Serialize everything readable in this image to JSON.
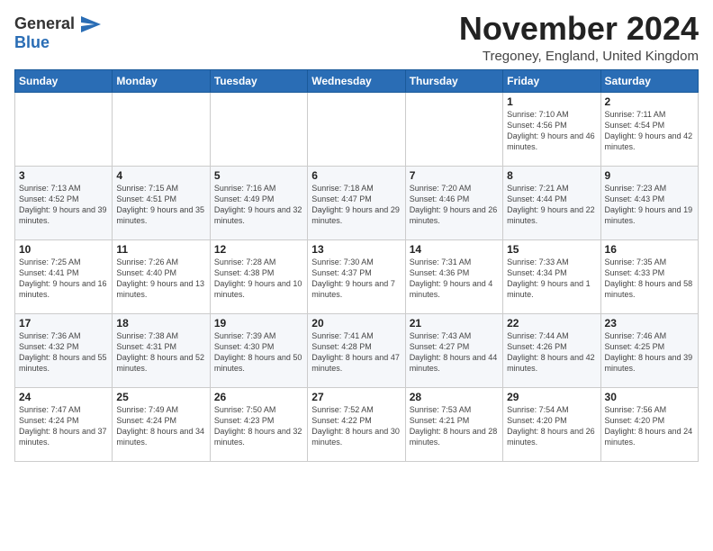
{
  "logo": {
    "line1": "General",
    "line2": "Blue"
  },
  "title": "November 2024",
  "location": "Tregoney, England, United Kingdom",
  "weekdays": [
    "Sunday",
    "Monday",
    "Tuesday",
    "Wednesday",
    "Thursday",
    "Friday",
    "Saturday"
  ],
  "weeks": [
    [
      {
        "day": "",
        "info": ""
      },
      {
        "day": "",
        "info": ""
      },
      {
        "day": "",
        "info": ""
      },
      {
        "day": "",
        "info": ""
      },
      {
        "day": "",
        "info": ""
      },
      {
        "day": "1",
        "info": "Sunrise: 7:10 AM\nSunset: 4:56 PM\nDaylight: 9 hours and 46 minutes."
      },
      {
        "day": "2",
        "info": "Sunrise: 7:11 AM\nSunset: 4:54 PM\nDaylight: 9 hours and 42 minutes."
      }
    ],
    [
      {
        "day": "3",
        "info": "Sunrise: 7:13 AM\nSunset: 4:52 PM\nDaylight: 9 hours and 39 minutes."
      },
      {
        "day": "4",
        "info": "Sunrise: 7:15 AM\nSunset: 4:51 PM\nDaylight: 9 hours and 35 minutes."
      },
      {
        "day": "5",
        "info": "Sunrise: 7:16 AM\nSunset: 4:49 PM\nDaylight: 9 hours and 32 minutes."
      },
      {
        "day": "6",
        "info": "Sunrise: 7:18 AM\nSunset: 4:47 PM\nDaylight: 9 hours and 29 minutes."
      },
      {
        "day": "7",
        "info": "Sunrise: 7:20 AM\nSunset: 4:46 PM\nDaylight: 9 hours and 26 minutes."
      },
      {
        "day": "8",
        "info": "Sunrise: 7:21 AM\nSunset: 4:44 PM\nDaylight: 9 hours and 22 minutes."
      },
      {
        "day": "9",
        "info": "Sunrise: 7:23 AM\nSunset: 4:43 PM\nDaylight: 9 hours and 19 minutes."
      }
    ],
    [
      {
        "day": "10",
        "info": "Sunrise: 7:25 AM\nSunset: 4:41 PM\nDaylight: 9 hours and 16 minutes."
      },
      {
        "day": "11",
        "info": "Sunrise: 7:26 AM\nSunset: 4:40 PM\nDaylight: 9 hours and 13 minutes."
      },
      {
        "day": "12",
        "info": "Sunrise: 7:28 AM\nSunset: 4:38 PM\nDaylight: 9 hours and 10 minutes."
      },
      {
        "day": "13",
        "info": "Sunrise: 7:30 AM\nSunset: 4:37 PM\nDaylight: 9 hours and 7 minutes."
      },
      {
        "day": "14",
        "info": "Sunrise: 7:31 AM\nSunset: 4:36 PM\nDaylight: 9 hours and 4 minutes."
      },
      {
        "day": "15",
        "info": "Sunrise: 7:33 AM\nSunset: 4:34 PM\nDaylight: 9 hours and 1 minute."
      },
      {
        "day": "16",
        "info": "Sunrise: 7:35 AM\nSunset: 4:33 PM\nDaylight: 8 hours and 58 minutes."
      }
    ],
    [
      {
        "day": "17",
        "info": "Sunrise: 7:36 AM\nSunset: 4:32 PM\nDaylight: 8 hours and 55 minutes."
      },
      {
        "day": "18",
        "info": "Sunrise: 7:38 AM\nSunset: 4:31 PM\nDaylight: 8 hours and 52 minutes."
      },
      {
        "day": "19",
        "info": "Sunrise: 7:39 AM\nSunset: 4:30 PM\nDaylight: 8 hours and 50 minutes."
      },
      {
        "day": "20",
        "info": "Sunrise: 7:41 AM\nSunset: 4:28 PM\nDaylight: 8 hours and 47 minutes."
      },
      {
        "day": "21",
        "info": "Sunrise: 7:43 AM\nSunset: 4:27 PM\nDaylight: 8 hours and 44 minutes."
      },
      {
        "day": "22",
        "info": "Sunrise: 7:44 AM\nSunset: 4:26 PM\nDaylight: 8 hours and 42 minutes."
      },
      {
        "day": "23",
        "info": "Sunrise: 7:46 AM\nSunset: 4:25 PM\nDaylight: 8 hours and 39 minutes."
      }
    ],
    [
      {
        "day": "24",
        "info": "Sunrise: 7:47 AM\nSunset: 4:24 PM\nDaylight: 8 hours and 37 minutes."
      },
      {
        "day": "25",
        "info": "Sunrise: 7:49 AM\nSunset: 4:24 PM\nDaylight: 8 hours and 34 minutes."
      },
      {
        "day": "26",
        "info": "Sunrise: 7:50 AM\nSunset: 4:23 PM\nDaylight: 8 hours and 32 minutes."
      },
      {
        "day": "27",
        "info": "Sunrise: 7:52 AM\nSunset: 4:22 PM\nDaylight: 8 hours and 30 minutes."
      },
      {
        "day": "28",
        "info": "Sunrise: 7:53 AM\nSunset: 4:21 PM\nDaylight: 8 hours and 28 minutes."
      },
      {
        "day": "29",
        "info": "Sunrise: 7:54 AM\nSunset: 4:20 PM\nDaylight: 8 hours and 26 minutes."
      },
      {
        "day": "30",
        "info": "Sunrise: 7:56 AM\nSunset: 4:20 PM\nDaylight: 8 hours and 24 minutes."
      }
    ]
  ]
}
